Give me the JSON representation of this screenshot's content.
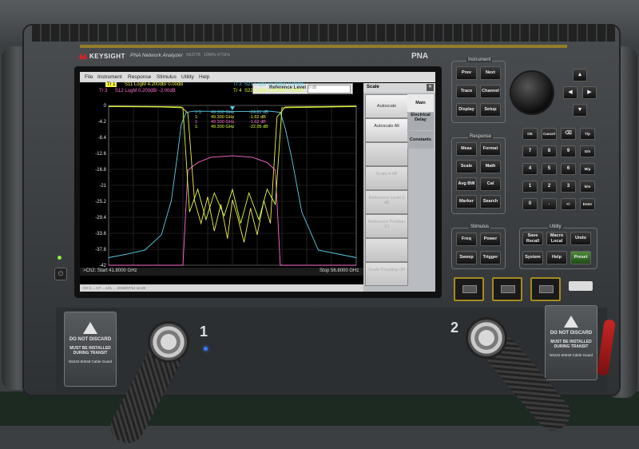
{
  "brand": {
    "logo": "KEYSIGHT",
    "model": "PNA Network Analyzer",
    "model_no": "N5227B",
    "range": "10MHz-67GHz",
    "family": "PNA"
  },
  "menu": [
    "File",
    "Instrument",
    "Response",
    "Stimulus",
    "Utility",
    "Help"
  ],
  "toolbar": {
    "ref_level_label": "Reference Level",
    "ref_level_value": "0 dB"
  },
  "softpanel": {
    "title": "Scale",
    "close": "✕",
    "keys": [
      "Autoscale",
      "Autoscale All",
      "",
      "Scale 4 dB",
      "Reference Level 0 dB",
      "Reference Position 10",
      "",
      "Scale Coupling Off"
    ],
    "tabs": [
      "Main",
      "Electrical Delay",
      "Constants"
    ]
  },
  "traces": {
    "hdr": [
      {
        "id": "Tr 1",
        "text": "S11 LogM 4.200dB/ 0.00dB",
        "color": "#f2f04a"
      },
      {
        "id": "Tr 2",
        "text": "S21 LogM 10.00dB/ 0.00dB",
        "color": "#5fd0e6"
      },
      {
        "id": "Tr 3",
        "text": "S12 LogM 0.200dB/ -2.00dB",
        "color": "#ff6fd0"
      },
      {
        "id": "Tr 4",
        "text": "S22 LogM 4.200dB/ 0.00dB",
        "color": "#d9ff3a"
      }
    ],
    "markers": [
      {
        "label": "> 1:",
        "freq": "49.300 GHz",
        "val": "-24.81 dB"
      },
      {
        "label": "1:",
        "freq": "49.300 GHz",
        "val": "-1.62 dB"
      },
      {
        "label": "1:",
        "freq": "49.300 GHz",
        "val": "-1.62 dB"
      },
      {
        "label": "1:",
        "freq": "49.300 GHz",
        "val": "-22.05 dB"
      }
    ],
    "start": ">Ch2: Start 41.8000 GHz",
    "stop": "Stop 56.8000 GHz",
    "status": "CH 1 ... C? ... LCL ... 2016/07/12 14:29"
  },
  "chart_data": {
    "type": "line",
    "title": "",
    "xlabel": "",
    "ylabel": "",
    "xlim": [
      41.8,
      56.8
    ],
    "ylim": [
      -42,
      0
    ],
    "yticks": [
      "0",
      "-4.2",
      "-8.4",
      "-12.6",
      "-16.8",
      "-21",
      "-25.2",
      "-29.4",
      "-33.6",
      "-37.8",
      "-42"
    ],
    "grid": true,
    "series": [
      {
        "name": "S11",
        "color": "#f2f04a",
        "x": [
          41.8,
          45,
          46.2,
          46.6,
          47.0,
          47.4,
          47.8,
          48.2,
          48.6,
          49.0,
          49.3,
          49.6,
          50.0,
          50.4,
          50.8,
          51.2,
          51.6,
          52.0,
          52.5,
          56.8
        ],
        "y": [
          -0.2,
          -0.3,
          -0.4,
          -2,
          -25,
          -31,
          -24,
          -33,
          -26,
          -35,
          -24.8,
          -29,
          -36,
          -27,
          -34,
          -25,
          -31,
          -3,
          -0.4,
          -0.2
        ]
      },
      {
        "name": "S21",
        "color": "#5fd0e6",
        "x": [
          41.8,
          43,
          44,
          45,
          45.6,
          46.0,
          46.2,
          46.5,
          47,
          49.3,
          51.5,
          52.2,
          52.5,
          52.9,
          53.5,
          54.5,
          56.8
        ],
        "y": [
          -40,
          -39,
          -38,
          -34,
          -25,
          -12,
          -5,
          -1.8,
          -1.5,
          -1.62,
          -1.5,
          -1.8,
          -6,
          -14,
          -28,
          -38,
          -40
        ]
      },
      {
        "name": "S12",
        "color": "#ff6fd0",
        "x": [
          41.8,
          46.3,
          46.6,
          47.2,
          48,
          49.3,
          50.5,
          51.4,
          51.9,
          52.2,
          56.8
        ],
        "y": [
          -42,
          -42,
          -17,
          -15,
          -13.6,
          -13.2,
          -13.6,
          -15,
          -17,
          -42,
          -42
        ]
      },
      {
        "name": "S22",
        "color": "#d9ff3a",
        "x": [
          41.8,
          45,
          46.3,
          46.7,
          47.2,
          47.7,
          48.2,
          48.8,
          49.3,
          49.8,
          50.3,
          50.9,
          51.4,
          51.9,
          52.3,
          56.8
        ],
        "y": [
          -0.3,
          -0.4,
          -0.6,
          -28,
          -22,
          -30,
          -23,
          -29,
          -22.05,
          -31,
          -23,
          -30,
          -22,
          -26,
          -0.6,
          -0.3
        ]
      }
    ]
  },
  "instrument_panel": {
    "instrument": {
      "title": "Instrument",
      "buttons": [
        "Prev",
        "Next",
        "Trace",
        "Channel",
        "Display",
        "Setup"
      ]
    },
    "response": {
      "title": "Response",
      "buttons": [
        "Meas",
        "Format",
        "Scale",
        "Math",
        "Avg BW",
        "Cal",
        "Marker",
        "Search"
      ]
    },
    "stimulus": {
      "title": "Stimulus",
      "buttons": [
        "Freq",
        "Power",
        "Sweep",
        "Trigger"
      ]
    },
    "utility": {
      "title": "Utility",
      "buttons": [
        "Save Recall",
        "Macro Local",
        "Undo",
        "System",
        "Help",
        "Preset"
      ]
    },
    "keypad": [
      "OK",
      "Cancel",
      "⌫",
      "T/p",
      "7",
      "8",
      "9",
      "G/n",
      "4",
      "5",
      "6",
      "M/μ",
      "1",
      "2",
      "3",
      "k/m",
      "0",
      ".",
      "+/-",
      "Enter"
    ]
  },
  "ports": {
    "port1": "1",
    "port2": "2"
  },
  "guards": {
    "line1": "DO NOT DISCARD",
    "line2": "MUST BE INSTALLED DURING TRANSIT",
    "line3": "N5242-60048 Cable Guard"
  }
}
